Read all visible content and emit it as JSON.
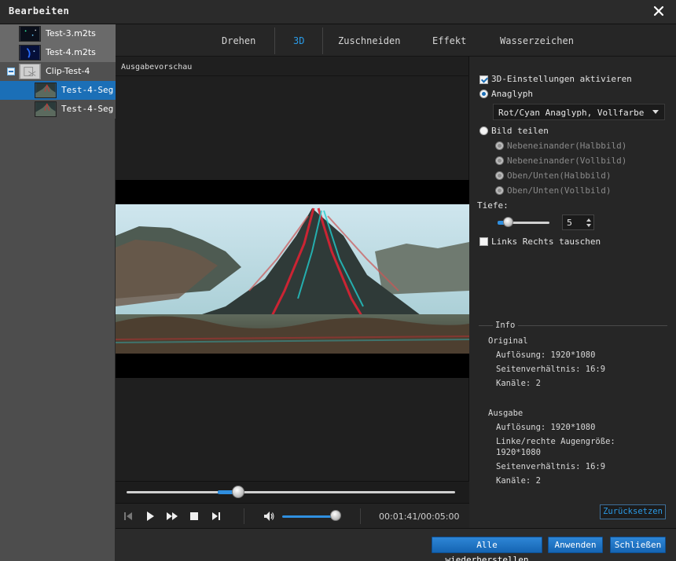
{
  "window": {
    "title": "Bearbeiten"
  },
  "sidebar": {
    "items": [
      {
        "label": "Test-3.m2ts",
        "type": "file"
      },
      {
        "label": "Test-4.m2ts",
        "type": "file"
      },
      {
        "label": "Clip-Test-4",
        "type": "clip",
        "expanded": true
      },
      {
        "label": "Test-4-Seg•",
        "type": "segment",
        "selected": true
      },
      {
        "label": "Test-4-Seg•",
        "type": "segment",
        "selected": false
      }
    ]
  },
  "tabs": [
    {
      "label": "Drehen"
    },
    {
      "label": "3D",
      "active": true
    },
    {
      "label": "Zuschneiden"
    },
    {
      "label": "Effekt"
    },
    {
      "label": "Wasserzeichen"
    }
  ],
  "preview": {
    "label": "Ausgabevorschau",
    "timecode": "00:01:41/00:05:00",
    "seek_progress": 0.34,
    "volume_level": 0.95
  },
  "settings": {
    "enable_3d_label": "3D-Einstellungen aktivieren",
    "enable_3d_checked": true,
    "anaglyph_label": "Anaglyph",
    "anaglyph_mode": "Rot/Cyan Anaglyph, Vollfarbe",
    "split_label": "Bild teilen",
    "split_options": [
      "Nebeneinander(Halbbild)",
      "Nebeneinander(Vollbild)",
      "Oben/Unten(Halbbild)",
      "Oben/Unten(Vollbild)"
    ],
    "depth_label": "Tiefe:",
    "depth_value": "5",
    "depth_slider": 0.2,
    "swap_label": "Links Rechts tauschen",
    "swap_checked": false
  },
  "info": {
    "heading": "Info",
    "original_heading": "Original",
    "original_resolution": "Auflösung: 1920*1080",
    "original_aspect": "Seitenverhältnis: 16:9",
    "original_channels": "Kanäle: 2",
    "output_heading": "Ausgabe",
    "output_resolution": "Auflösung: 1920*1080",
    "output_eye_label": "Linke/rechte Augengröße:",
    "output_eye_value": "1920*1080",
    "output_aspect": "Seitenverhältnis: 16:9",
    "output_channels": "Kanäle: 2"
  },
  "buttons": {
    "reset": "Zurücksetzen",
    "restore_all": "Alle wiederherstellen",
    "apply": "Anwenden",
    "close": "Schließen"
  },
  "colors": {
    "accent": "#2a9be8",
    "selection": "#1b6fb7",
    "button": "#1e74c8"
  }
}
